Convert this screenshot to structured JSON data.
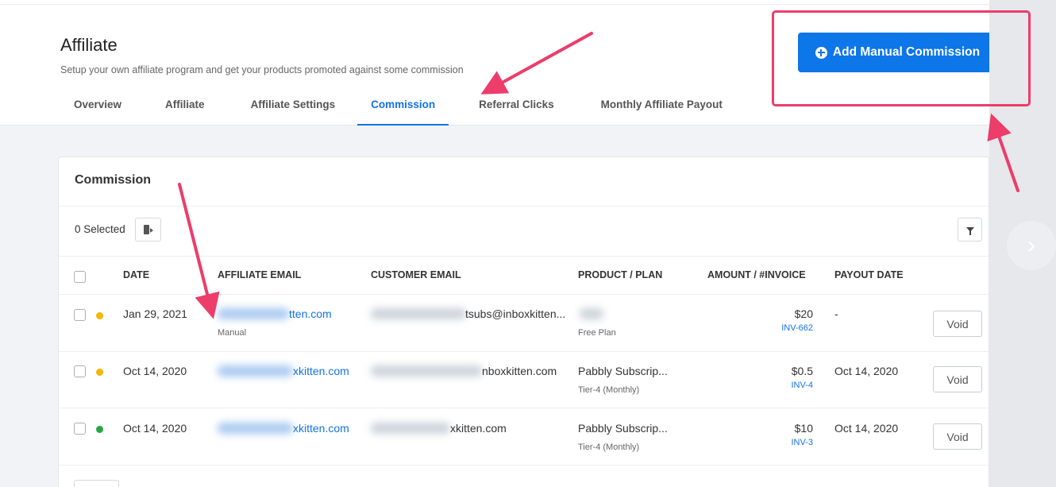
{
  "header": {
    "title": "Affiliate",
    "subtitle": "Setup your own affiliate program and get your products promoted against some commission",
    "add_button_label": "Add Manual Commission"
  },
  "tabs": [
    {
      "label": "Overview",
      "active": false
    },
    {
      "label": "Affiliate",
      "active": false
    },
    {
      "label": "Affiliate Settings",
      "active": false
    },
    {
      "label": "Commission",
      "active": true
    },
    {
      "label": "Referral Clicks",
      "active": false
    },
    {
      "label": "Monthly Affiliate Payout",
      "active": false
    }
  ],
  "commission": {
    "title": "Commission",
    "selected_text": "0 Selected",
    "columns": [
      "DATE",
      "AFFILIATE EMAIL",
      "CUSTOMER EMAIL",
      "PRODUCT / PLAN",
      "AMOUNT / #INVOICE",
      "PAYOUT DATE"
    ],
    "rows": [
      {
        "status_color": "#f5b800",
        "date": "Jan 29, 2021",
        "affiliate_email": "tten.com",
        "affiliate_sub": "Manual",
        "customer_email": "tsubs@inboxkitten...",
        "product": "",
        "plan": "Free Plan",
        "amount": "$20",
        "invoice": "INV-662",
        "payout_date": "-",
        "action": "Void"
      },
      {
        "status_color": "#f5b800",
        "date": "Oct 14, 2020",
        "affiliate_email": "xkitten.com",
        "affiliate_sub": "",
        "customer_email": "nboxkitten.com",
        "product": "Pabbly Subscrip...",
        "plan": "Tier-4 (Monthly)",
        "amount": "$0.5",
        "invoice": "INV-4",
        "payout_date": "Oct 14, 2020",
        "action": "Void"
      },
      {
        "status_color": "#27a844",
        "date": "Oct 14, 2020",
        "affiliate_email": "xkitten.com",
        "affiliate_sub": "",
        "customer_email": "xkitten.com",
        "product": "Pabbly Subscrip...",
        "plan": "Tier-4 (Monthly)",
        "amount": "$10",
        "invoice": "INV-3",
        "payout_date": "Oct 14, 2020",
        "action": "Void"
      }
    ]
  },
  "colors": {
    "accent": "#1473e6",
    "button": "#0d76e8",
    "annotation": "#ec3d6b"
  }
}
